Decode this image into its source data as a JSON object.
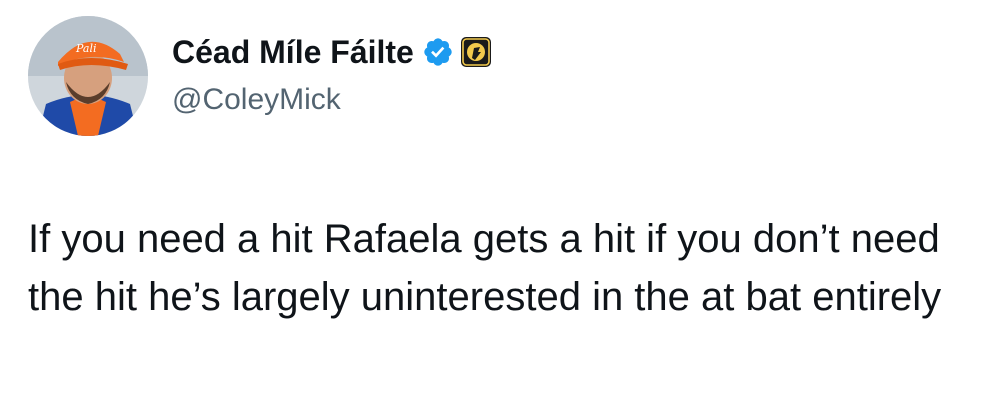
{
  "author": {
    "display_name": "Céad Míle Fáilte",
    "handle": "@ColeyMick",
    "verified_icon": "verified-badge-icon",
    "affiliation_icon": "affiliate-badge-icon",
    "avatar": "avatar-photo"
  },
  "tweet": {
    "text": "If you need a hit Rafaela gets a hit if you don’t need the hit he’s largely uninterested in the at bat entirely"
  },
  "colors": {
    "text_primary": "#0f1419",
    "text_secondary": "#536471",
    "verified_blue": "#1d9bf0",
    "affiliate_dark": "#1a1a1a",
    "affiliate_gold": "#f2c94c"
  }
}
